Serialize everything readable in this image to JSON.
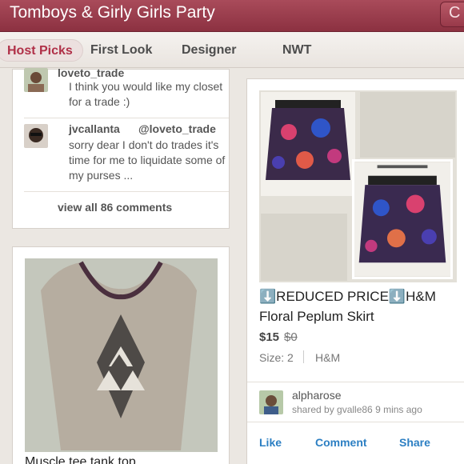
{
  "header": {
    "title": "Tomboys & Girly Girls Party",
    "action_glyph": "C"
  },
  "tabs": [
    "Host Picks",
    "First Look",
    "Designer",
    "NWT"
  ],
  "comments": [
    {
      "user": "loveto_trade",
      "text": "I think you would like my closet for a trade :)"
    },
    {
      "user": "jvcallanta",
      "mention": "@loveto_trade",
      "text": "sorry dear I don't do trades it's time for me to liquidate some of my purses ..."
    }
  ],
  "view_all": "view all 86 comments",
  "listing_left": {
    "title": "Muscle tee tank top"
  },
  "listing_right": {
    "title_line1": "⬇️REDUCED PRICE⬇️H&M",
    "title_line2": "Floral Peplum Skirt",
    "price": "$15",
    "original_price": "$0",
    "size": "Size: 2",
    "brand": "H&M",
    "seller": "alpharose",
    "shared_by": "shared by gvalle86 9 mins ago",
    "actions": {
      "like": "Like",
      "comment": "Comment",
      "share": "Share"
    }
  },
  "colors": {
    "accent": "#b03048",
    "link": "#2c7fc3",
    "header": "#9b3b4b"
  }
}
